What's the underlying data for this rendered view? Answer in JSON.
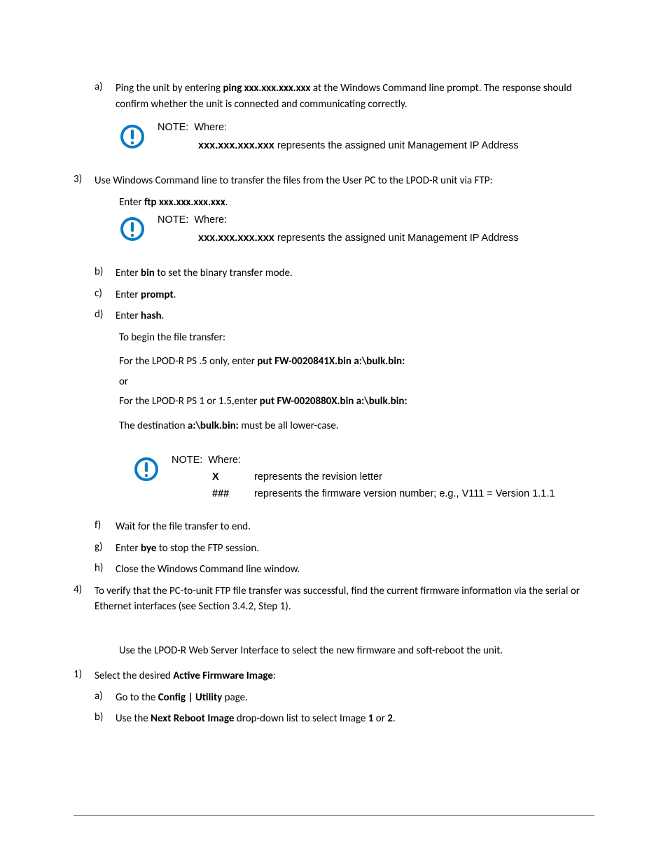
{
  "item_a_marker": "a)",
  "item_a_prefix": "Ping the unit by entering ",
  "item_a_cmd": "ping xxx.xxx.xxx.xxx",
  "item_a_suffix": " at the Windows Command line prompt. The response should confirm whether the unit is connected and communicating correctly.",
  "note_label": "NOTE:",
  "note_where": "Where:",
  "note_ip_key": "xxx.xxx.xxx.xxx",
  "note_ip_val": " represents the assigned unit Management IP Address",
  "step3_marker": "3)",
  "step3_text": "Use Windows Command line to transfer the files from the User PC to the LPOD-R unit via FTP:",
  "step3_enter": "Enter ",
  "step3_cmd": "ftp xxx.xxx.xxx.xxx",
  "step3_period": ".",
  "item_b_marker": "b)",
  "item_b_prefix": "Enter ",
  "item_b_cmd": "bin",
  "item_b_suffix": " to set the binary transfer mode.",
  "item_c_marker": "c)",
  "item_c_prefix": "Enter ",
  "item_c_cmd": "prompt",
  "item_c_suffix": ".",
  "item_d_marker": "d)",
  "item_d_prefix": "Enter ",
  "item_d_cmd": "hash",
  "item_d_suffix": ".",
  "begin_transfer": "To begin the file transfer:",
  "ps5_prefix": "For the LPOD-R PS .5 only, enter ",
  "ps5_cmd": "put FW-0020841X.bin a:\\bulk.bin:",
  "or": "or",
  "ps1_prefix": "For the LPOD-R PS 1 or 1.5,enter ",
  "ps1_cmd": "put FW-0020880X.bin a:\\bulk.bin:",
  "dest_prefix": "The destination ",
  "dest_cmd": "a:\\bulk.bin:",
  "dest_suffix": " must be all lower-case.",
  "note3_x_key": "X",
  "note3_x_val": "represents the revision letter",
  "note3_h_key": "###",
  "note3_h_val": "represents the firmware version number; e.g., V111 = Version 1.1.1",
  "item_f_marker": "f)",
  "item_f_text": "Wait for the file transfer to end.",
  "item_g_marker": "g)",
  "item_g_prefix": "Enter ",
  "item_g_cmd": "bye",
  "item_g_suffix": " to stop the FTP session.",
  "item_h_marker": "h)",
  "item_h_text": "Close the Windows Command line window.",
  "step4_marker": "4)",
  "step4_text": "To verify that the PC-to-unit FTP file transfer was successful, find the current firmware information via the serial or Ethernet interfaces (see Section 3.4.2, Step 1).",
  "web_intro": "Use the LPOD-R Web Server Interface to select the new firmware and soft-reboot the unit.",
  "step1b_marker": "1)",
  "step1b_prefix": "Select the desired ",
  "step1b_bold": "Active Firmware Image",
  "step1b_suffix": ":",
  "sub_a_marker": "a)",
  "sub_a_prefix": "Go to the ",
  "sub_a_bold": "Config | Utility",
  "sub_a_suffix": " page.",
  "sub_b_marker": "b)",
  "sub_b_prefix": "Use the ",
  "sub_b_bold": "Next Reboot Image",
  "sub_b_mid": " drop-down list to select Image ",
  "sub_b_1": "1",
  "sub_b_or": " or ",
  "sub_b_2": "2",
  "sub_b_suffix": "."
}
